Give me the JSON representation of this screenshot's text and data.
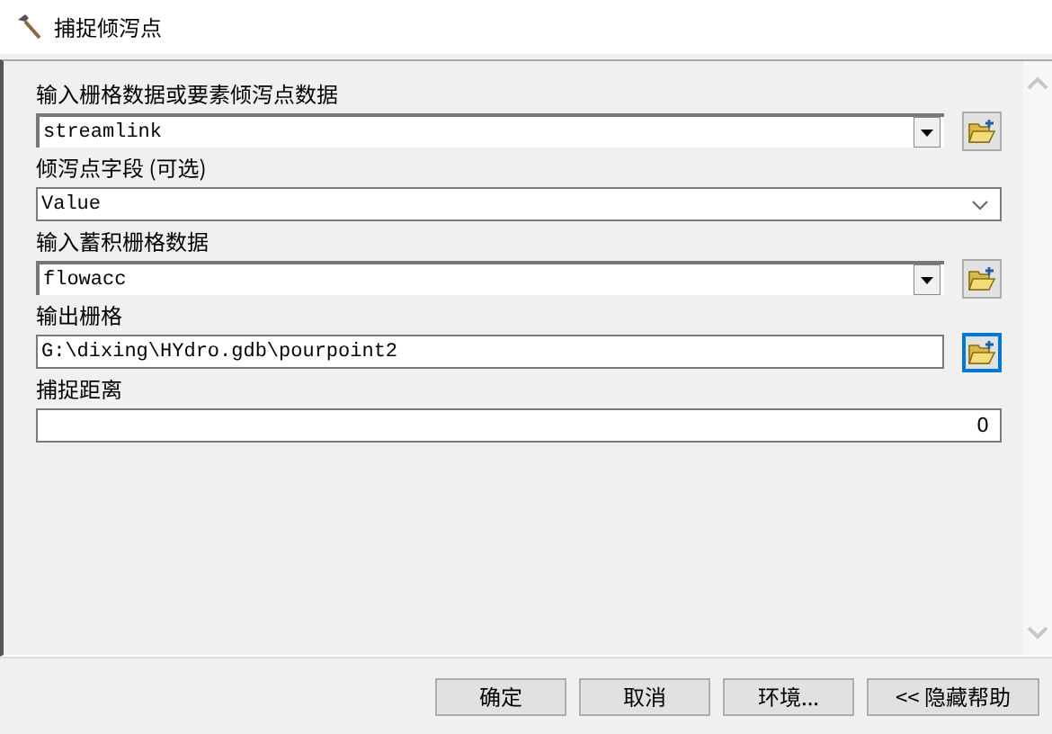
{
  "window": {
    "title": "捕捉倾泻点"
  },
  "parameters": [
    {
      "label": "输入栅格数据或要素倾泻点数据",
      "value": "streamlink",
      "kind": "dropdown-browse",
      "browse_focused": false
    },
    {
      "label": "倾泻点字段 (可选)",
      "value": "Value",
      "kind": "dropdown"
    },
    {
      "label": "输入蓄积栅格数据",
      "value": "flowacc",
      "kind": "dropdown-browse",
      "browse_focused": false
    },
    {
      "label": "输出栅格",
      "value": "G:\\dixing\\HYdro.gdb\\pourpoint2",
      "kind": "text-browse",
      "browse_focused": true
    },
    {
      "label": "捕捉距离",
      "value": "0",
      "kind": "number"
    }
  ],
  "buttons": [
    "确定",
    "取消",
    "环境...",
    "<< 隐藏帮助"
  ]
}
